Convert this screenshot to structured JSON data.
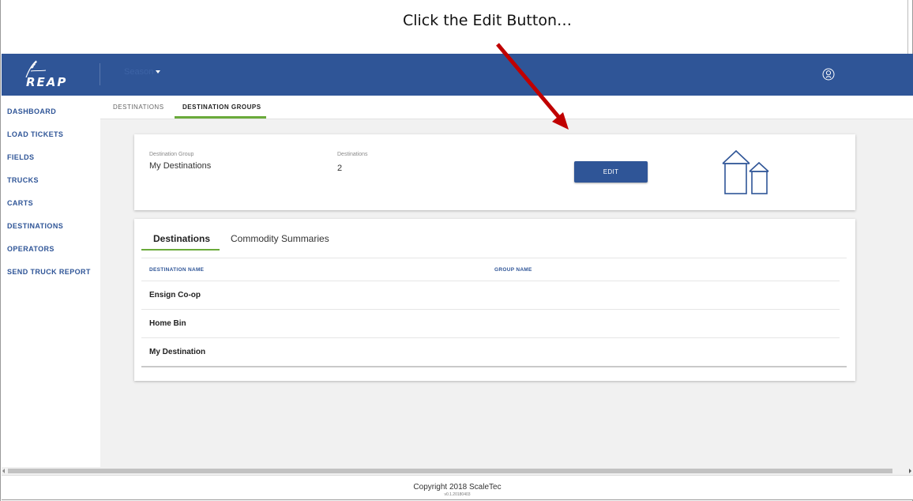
{
  "caption": "Click the Edit Button…",
  "app": {
    "logo_text": "REAP",
    "season_label": "Season"
  },
  "sidebar": {
    "items": [
      {
        "label": "DASHBOARD"
      },
      {
        "label": "LOAD TICKETS"
      },
      {
        "label": "FIELDS"
      },
      {
        "label": "TRUCKS"
      },
      {
        "label": "CARTS"
      },
      {
        "label": "DESTINATIONS"
      },
      {
        "label": "OPERATORS"
      },
      {
        "label": "SEND TRUCK REPORT"
      }
    ]
  },
  "tabs": [
    {
      "label": "DESTINATIONS",
      "active": false
    },
    {
      "label": "DESTINATION GROUPS",
      "active": true
    }
  ],
  "group_card": {
    "group_label": "Destination Group",
    "group_value": "My Destinations",
    "destinations_label": "Destinations",
    "destinations_value": "2",
    "edit_label": "EDIT",
    "icon": "silo-icon"
  },
  "detail_card": {
    "subtabs": [
      {
        "label": "Destinations",
        "active": true
      },
      {
        "label": "Commodity Summaries",
        "active": false
      }
    ],
    "columns": [
      "DESTINATION NAME",
      "GROUP NAME"
    ],
    "rows": [
      {
        "destination": "Ensign Co-op",
        "group": ""
      },
      {
        "destination": "Home Bin",
        "group": ""
      },
      {
        "destination": "My Destination",
        "group": ""
      }
    ]
  },
  "footer": {
    "copyright": "Copyright 2018 ScaleTec",
    "version": "v0.1.20180403"
  },
  "colors": {
    "brand": "#2f5597",
    "accent": "#6aaa3a",
    "arrow": "#c00000"
  }
}
